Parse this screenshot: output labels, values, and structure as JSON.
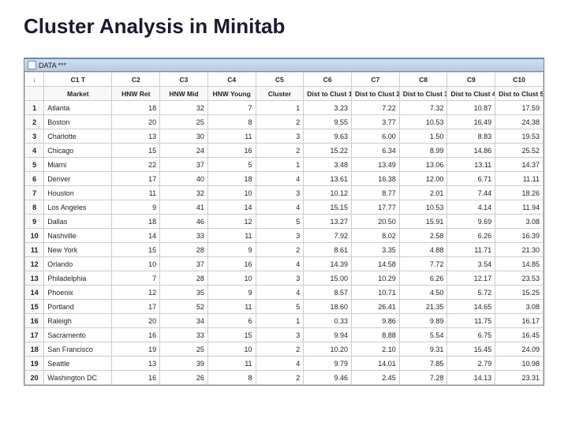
{
  "title": "Cluster Analysis in Minitab",
  "window_label": "DATA ***",
  "col_ids": [
    "C1 T",
    "C2",
    "C3",
    "C4",
    "C5",
    "C6",
    "C7",
    "C8",
    "C9",
    "C10"
  ],
  "col_names": [
    "Market",
    "HNW Ret",
    "HNW Mid",
    "HNW Young",
    "Cluster",
    "Dist to Clust 1",
    "Dist to Clust 2",
    "Dist to Clust 3",
    "Dist to Clust 4",
    "Dist to Clust 5"
  ],
  "rows": [
    {
      "n": 1,
      "market": "Atlanta",
      "v": [
        18,
        32,
        7,
        1,
        "3.23",
        "7.22",
        "7.32",
        "10.87",
        "17.59"
      ]
    },
    {
      "n": 2,
      "market": "Boston",
      "v": [
        20,
        25,
        8,
        2,
        "9.55",
        "3.77",
        "10.53",
        "16.49",
        "24.38"
      ]
    },
    {
      "n": 3,
      "market": "Charlotte",
      "v": [
        13,
        30,
        11,
        3,
        "9.63",
        "6.00",
        "1.50",
        "8.83",
        "19.53"
      ]
    },
    {
      "n": 4,
      "market": "Chicago",
      "v": [
        15,
        24,
        16,
        2,
        "15.22",
        "6.34",
        "8.99",
        "14.86",
        "25.52"
      ]
    },
    {
      "n": 5,
      "market": "Miami",
      "v": [
        22,
        37,
        5,
        1,
        "3.48",
        "13.49",
        "13.06",
        "13.11",
        "14.37"
      ]
    },
    {
      "n": 6,
      "market": "Denver",
      "v": [
        17,
        40,
        18,
        4,
        "13.61",
        "16.38",
        "12.00",
        "6.71",
        "11.11"
      ]
    },
    {
      "n": 7,
      "market": "Houston",
      "v": [
        11,
        32,
        10,
        3,
        "10.12",
        "8.77",
        "2.01",
        "7.44",
        "18.26"
      ]
    },
    {
      "n": 8,
      "market": "Los Angeles",
      "v": [
        9,
        41,
        14,
        4,
        "15.15",
        "17.77",
        "10.53",
        "4.14",
        "11.94"
      ]
    },
    {
      "n": 9,
      "market": "Dallas",
      "v": [
        18,
        46,
        12,
        5,
        "13.27",
        "20.50",
        "15.91",
        "9.69",
        "3.08"
      ]
    },
    {
      "n": 10,
      "market": "Nashville",
      "v": [
        14,
        33,
        11,
        3,
        "7.92",
        "8.02",
        "2.58",
        "6.26",
        "16.39"
      ]
    },
    {
      "n": 11,
      "market": "New York",
      "v": [
        15,
        28,
        9,
        2,
        "8.61",
        "3.35",
        "4.88",
        "11.71",
        "21.30"
      ]
    },
    {
      "n": 12,
      "market": "Orlando",
      "v": [
        10,
        37,
        16,
        4,
        "14.39",
        "14.58",
        "7.72",
        "3.54",
        "14.85"
      ]
    },
    {
      "n": 13,
      "market": "Philadelphia",
      "v": [
        7,
        28,
        10,
        3,
        "15.00",
        "10.29",
        "6.26",
        "12.17",
        "23.53"
      ]
    },
    {
      "n": 14,
      "market": "Phoenix",
      "v": [
        12,
        35,
        9,
        4,
        "8.57",
        "10.71",
        "4.50",
        "5.72",
        "15.25"
      ]
    },
    {
      "n": 15,
      "market": "Portland",
      "v": [
        17,
        52,
        11,
        5,
        "18.60",
        "26.41",
        "21.35",
        "14.65",
        "3.08"
      ]
    },
    {
      "n": 16,
      "market": "Raleigh",
      "v": [
        20,
        34,
        6,
        1,
        "0.33",
        "9.86",
        "9.89",
        "11.75",
        "16.17"
      ]
    },
    {
      "n": 17,
      "market": "Sacramento",
      "v": [
        16,
        33,
        15,
        3,
        "9.94",
        "8.88",
        "5.54",
        "6.75",
        "16.45"
      ]
    },
    {
      "n": 18,
      "market": "San Francisco",
      "v": [
        19,
        25,
        10,
        2,
        "10.20",
        "2.10",
        "9.31",
        "15.45",
        "24.09"
      ]
    },
    {
      "n": 19,
      "market": "Seattle",
      "v": [
        13,
        39,
        11,
        4,
        "9.79",
        "14.01",
        "7.85",
        "2.79",
        "10.98"
      ]
    },
    {
      "n": 20,
      "market": "Washington DC",
      "v": [
        16,
        26,
        8,
        2,
        "9.46",
        "2.45",
        "7.28",
        "14.13",
        "23.31"
      ]
    }
  ],
  "corner_symbol": "↓"
}
